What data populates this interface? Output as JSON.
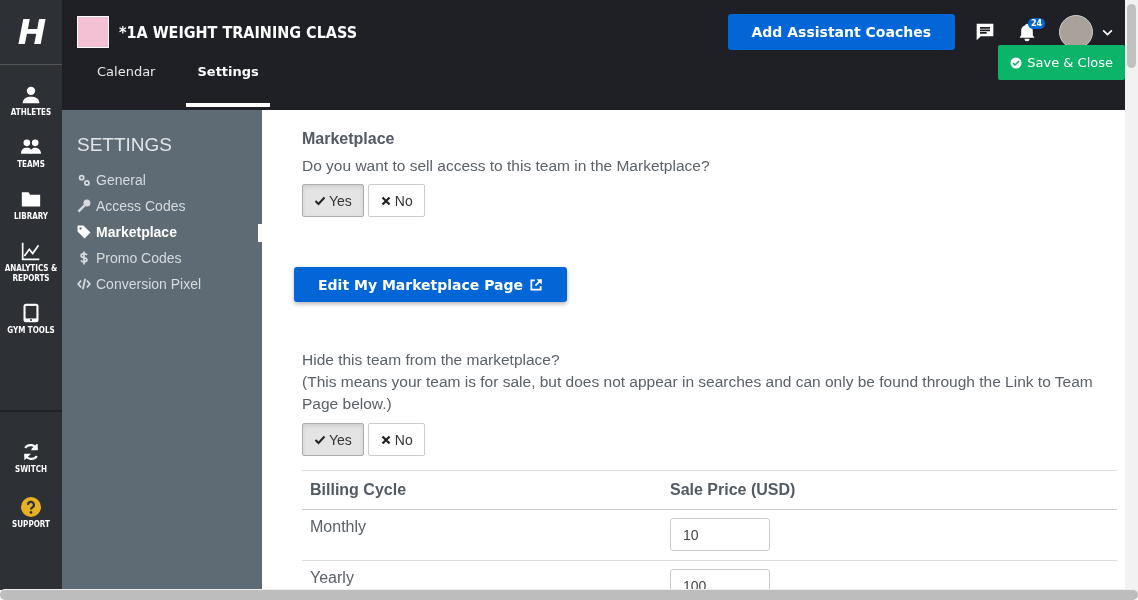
{
  "rail": {
    "logo": "H",
    "items": [
      {
        "label": "ATHLETES"
      },
      {
        "label": "TEAMS"
      },
      {
        "label": "LIBRARY"
      },
      {
        "label": "ANALYTICS & REPORTS"
      },
      {
        "label": "GYM TOOLS"
      }
    ],
    "bottom_items": [
      {
        "label": "SWITCH"
      },
      {
        "label": "SUPPORT"
      }
    ]
  },
  "header": {
    "team_title": "*1A WEIGHT TRAINING CLASS",
    "tabs": [
      {
        "label": "Calendar",
        "selected": false
      },
      {
        "label": "Settings",
        "selected": true
      }
    ],
    "add_button": "Add Assistant Coaches",
    "notification_count": "24",
    "save_button": "Save & Close"
  },
  "settings_nav": {
    "heading": "SETTINGS",
    "items": [
      {
        "label": "General",
        "selected": false
      },
      {
        "label": "Access Codes",
        "selected": false
      },
      {
        "label": "Marketplace",
        "selected": true
      },
      {
        "label": "Promo Codes",
        "selected": false
      },
      {
        "label": "Conversion Pixel",
        "selected": false
      }
    ]
  },
  "content": {
    "title": "Marketplace",
    "sell_question": "Do you want to sell access to this team in the Marketplace?",
    "sell_toggle": [
      {
        "label": "Yes",
        "selected": true
      },
      {
        "label": "No",
        "selected": false
      }
    ],
    "edit_button": "Edit My Marketplace Page",
    "hide_question": "Hide this team from the marketplace?",
    "hide_note": "(This means your team is for sale, but does not appear in searches and can only be found through the Link to Team Page below.)",
    "hide_toggle": [
      {
        "label": "Yes",
        "selected": true
      },
      {
        "label": "No",
        "selected": false
      }
    ],
    "table": {
      "columns": [
        "Billing Cycle",
        "Sale Price (USD)"
      ],
      "rows": [
        {
          "cycle": "Monthly",
          "price": "10"
        },
        {
          "cycle": "Yearly",
          "price": "100"
        }
      ]
    }
  }
}
